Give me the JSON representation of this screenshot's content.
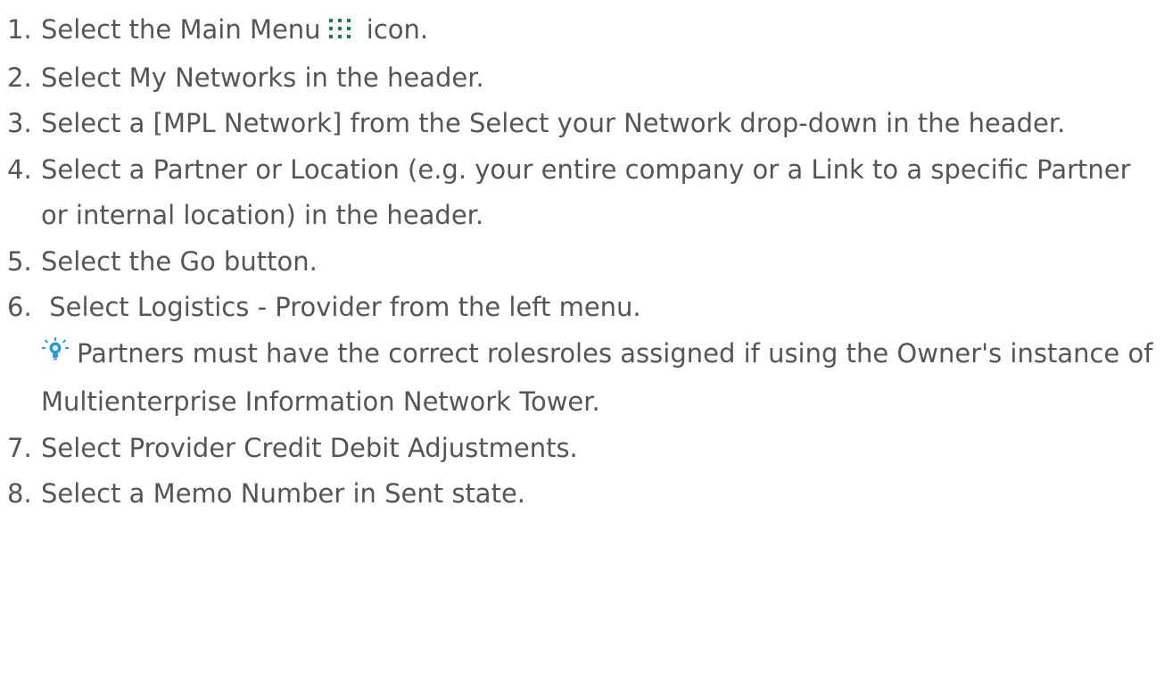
{
  "steps": [
    {
      "num": "1.",
      "before": "Select the Main Menu",
      "after": " icon.",
      "icon": "main-menu-grid-icon"
    },
    {
      "num": "2.",
      "text": "Select My Networks in the header."
    },
    {
      "num": "3.",
      "text": "Select a [MPL Network] from the Select your Network drop-down in the header."
    },
    {
      "num": "4.",
      "text": "Select a Partner or Location (e.g. your entire company or a Link to a specific Partner or internal location) in the header."
    },
    {
      "num": "5.",
      "text": "Select the Go button."
    },
    {
      "num": "6.",
      "text": " Select Logistics - Provider from the left menu.",
      "note": "Partners must have the correct rolesroles assigned if using the Owner's instance of Multienterprise Information Network Tower.",
      "note_icon": "lightbulb-tip-icon"
    },
    {
      "num": "7.",
      "text": "Select Provider Credit Debit Adjustments."
    },
    {
      "num": "8.",
      "text": "Select a Memo Number in Sent state."
    }
  ],
  "colors": {
    "text": "#555555",
    "menu_icon": "#1a7a4c",
    "tip_icon": "#2e9bd6"
  }
}
